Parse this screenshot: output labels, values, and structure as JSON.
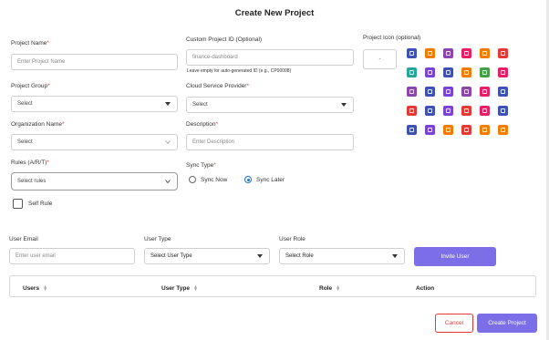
{
  "modal": {
    "title": "Create New Project"
  },
  "form": {
    "project_name": {
      "label": "Project Name",
      "placeholder": "Enter Project Name"
    },
    "custom_id": {
      "label": "Custom Project ID (Optional)",
      "placeholder": "finance-dashboard",
      "hint": "Leave empty for auto-generated ID (e.g., CP00008)"
    },
    "project_icon": {
      "label": "Project Icon (optional)",
      "value": "-"
    },
    "project_group": {
      "label": "Project Group",
      "value": "Select"
    },
    "cloud_provider": {
      "label": "Cloud Service Provider",
      "value": "Select"
    },
    "organization": {
      "label": "Organization Name",
      "value": "Select"
    },
    "description": {
      "label": "Description",
      "placeholder": "Enter Description"
    },
    "rules": {
      "label": "Rules (A/R/T)",
      "value": "Select rules"
    },
    "sync_type": {
      "label": "Sync Type",
      "options": [
        "Sync Now",
        "Sync Later"
      ],
      "selected": "Sync Later"
    },
    "self_rule": {
      "label": "Self Rule"
    },
    "required_mark": "*"
  },
  "icons": {
    "colors": [
      [
        "#3f51b5",
        "#f57c00",
        "#8e44ad",
        "#e91e63",
        "#f57c00",
        "#e53935"
      ],
      [
        "#26a69a",
        "#7b42d6",
        "#3f51b5",
        "#f57c00",
        "#43a047",
        "#e91e63"
      ],
      [
        "#8e44ad",
        "#3f51b5",
        "#7b42d6",
        "#8e44ad",
        "#e91e63",
        "#3f51b5"
      ],
      [
        "#e53935",
        "#3f51b5",
        "#7b42d6",
        "#e53935",
        "#e91e63",
        "#3f51b5"
      ],
      [
        "#3f51b5",
        "#7b42d6",
        "#f57c00",
        "#e53935",
        "#f57c00",
        "#f57c00"
      ]
    ]
  },
  "user_section": {
    "email": {
      "label": "User Email",
      "placeholder": "Enter user email"
    },
    "user_type": {
      "label": "User Type",
      "value": "Select User Type"
    },
    "user_role": {
      "label": "User Role",
      "value": "Select Role"
    },
    "invite_button": "Invite User"
  },
  "table": {
    "columns": [
      "Users",
      "User Type",
      "Role",
      "Action"
    ]
  },
  "footer": {
    "cancel": "Cancel",
    "create": "Create Project"
  }
}
